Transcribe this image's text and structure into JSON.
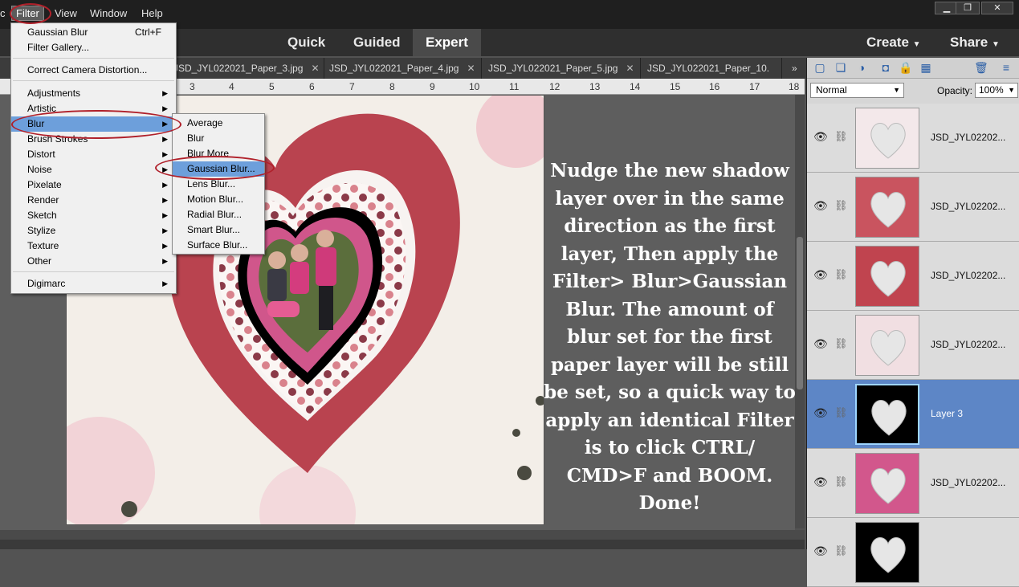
{
  "menubar": {
    "items": [
      "Filter",
      "View",
      "Window",
      "Help"
    ],
    "win_controls": [
      "▁",
      "❐",
      "✕"
    ]
  },
  "modes": [
    "Quick",
    "Guided",
    "Expert"
  ],
  "create_label": "Create",
  "share_label": "Share",
  "tabs": [
    "JSD_JYL022021_Paper_3.jpg",
    "JSD_JYL022021_Paper_4.jpg",
    "JSD_JYL022021_Paper_5.jpg",
    "JSD_JYL022021_Paper_10."
  ],
  "tab_overflow": "»",
  "ruler_ticks": [
    "3",
    "4",
    "5",
    "6",
    "7",
    "8",
    "9",
    "10",
    "11",
    "12",
    "13",
    "14",
    "15",
    "16",
    "17",
    "18"
  ],
  "filter_menu": {
    "top": [
      {
        "label": "Gaussian Blur",
        "shortcut": "Ctrl+F"
      },
      {
        "label": "Filter Gallery..."
      },
      {
        "label": "Correct Camera Distortion..."
      }
    ],
    "groups": [
      "Adjustments",
      "Artistic",
      "Blur",
      "Brush Strokes",
      "Distort",
      "Noise",
      "Pixelate",
      "Render",
      "Sketch",
      "Stylize",
      "Texture",
      "Other"
    ],
    "bottom": [
      "Digimarc"
    ]
  },
  "blur_menu": [
    "Average",
    "Blur",
    "Blur More",
    "Gaussian Blur...",
    "Lens Blur...",
    "Motion Blur...",
    "Radial Blur...",
    "Smart Blur...",
    "Surface Blur..."
  ],
  "instruction_text": "Nudge the new shadow layer over in the same direction as the first layer, Then apply the Filter> Blur>Gaussian Blur. The amount of blur set for the first paper layer will be still be set, so a quick way to apply an identical Filter is to click CTRL/ CMD>F and BOOM. Done!",
  "layers_panel": {
    "blend_mode": "Normal",
    "opacity_label": "Opacity:",
    "opacity_value": "100%",
    "layers": [
      {
        "name": "JSD_JYL02202...",
        "selected": false,
        "color": "#f3e8ea"
      },
      {
        "name": "JSD_JYL02202...",
        "selected": false,
        "color": "#c9545f"
      },
      {
        "name": "JSD_JYL02202...",
        "selected": false,
        "color": "#c0444f"
      },
      {
        "name": "JSD_JYL02202...",
        "selected": false,
        "color": "#f1dfe2"
      },
      {
        "name": "Layer 3",
        "selected": true,
        "color": "#000000"
      },
      {
        "name": "JSD_JYL02202...",
        "selected": false,
        "color": "#d2578c"
      },
      {
        "name": "",
        "selected": false,
        "color": "#000000"
      }
    ]
  },
  "colors": {
    "accent": "#6d9fdb",
    "highlight_ring": "#b0202a"
  }
}
